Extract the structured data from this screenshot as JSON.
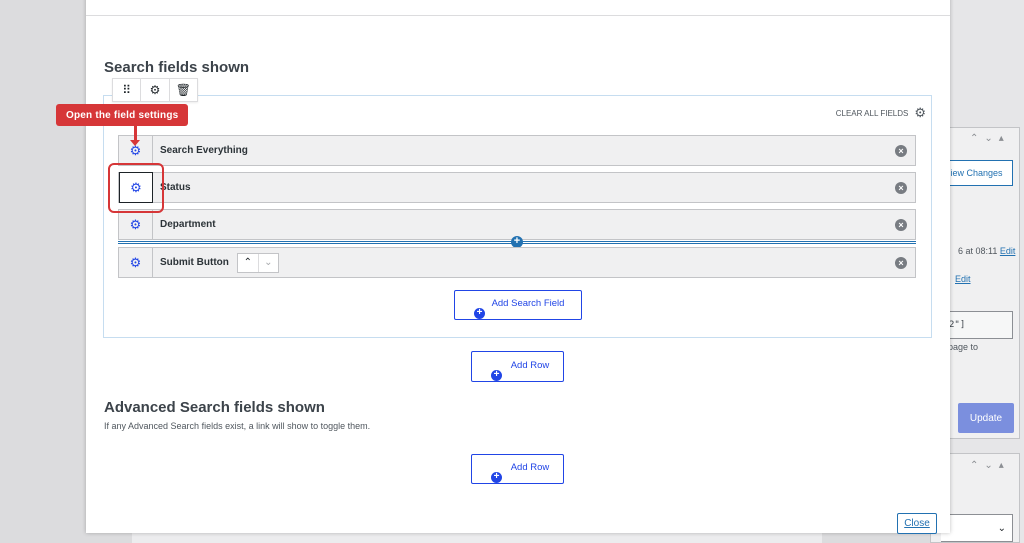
{
  "modal": {
    "search_fields_title": "Search fields shown",
    "advanced_title": "Advanced Search fields shown",
    "advanced_desc": "If any Advanced Search fields exist, a link will show to toggle them.",
    "clear_all_label": "CLEAR ALL FIELDS",
    "add_search_field_label": "Add Search Field",
    "add_row_label": "Add Row",
    "close_label": "Close",
    "toolbar_icons": [
      "drag-handle-icon",
      "gear-icon",
      "trash-icon"
    ]
  },
  "fields": [
    {
      "label": "Search Everything"
    },
    {
      "label": "Status"
    },
    {
      "label": "Department"
    },
    {
      "label": "Submit Button"
    }
  ],
  "callout": {
    "text": "Open the field settings"
  },
  "right_panel": {
    "view_changes": "iew Changes",
    "date_text": "6 at 08:11",
    "edit1": "Edit",
    "edit2": "Edit",
    "code": "2\"]",
    "page_to": "page to",
    "update_label": "Update"
  },
  "colors": {
    "accent": "#2145e6",
    "callout": "#d63638",
    "update_button": "#7b8fde"
  }
}
